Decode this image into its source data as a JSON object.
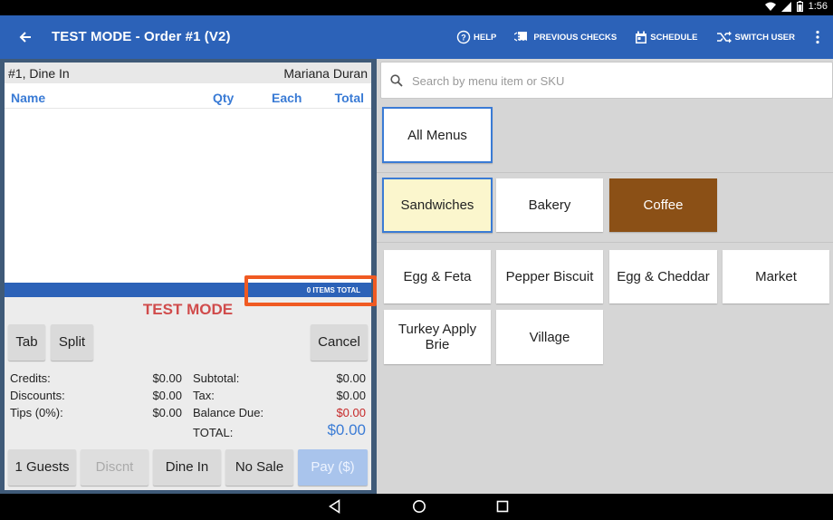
{
  "status": {
    "time": "1:56"
  },
  "appbar": {
    "title": "TEST MODE - Order #1 (V2)",
    "actions": [
      {
        "label": "HELP",
        "icon": "help-icon"
      },
      {
        "label": "PREVIOUS CHECKS",
        "icon": "checks-icon"
      },
      {
        "label": "SCHEDULE",
        "icon": "calendar-icon"
      },
      {
        "label": "SWITCH USER",
        "icon": "shuffle-icon"
      }
    ]
  },
  "order": {
    "header_left": "#1, Dine In",
    "header_right": "Mariana Duran",
    "columns": {
      "name": "Name",
      "qty": "Qty",
      "each": "Each",
      "total": "Total"
    },
    "items_total": "0 ITEMS TOTAL",
    "test_mode": "TEST MODE",
    "buttons": {
      "tab": "Tab",
      "split": "Split",
      "cancel": "Cancel"
    },
    "summary": {
      "credits_label": "Credits:",
      "credits": "$0.00",
      "discounts_label": "Discounts:",
      "discounts": "$0.00",
      "tips_label": "Tips (0%):",
      "tips": "$0.00",
      "subtotal_label": "Subtotal:",
      "subtotal": "$0.00",
      "tax_label": "Tax:",
      "tax": "$0.00",
      "balance_label": "Balance Due:",
      "balance": "$0.00",
      "total_label": "TOTAL:",
      "total": "$0.00"
    },
    "bottom_buttons": {
      "guests": "1 Guests",
      "discount": "Discnt",
      "dine_in": "Dine In",
      "no_sale": "No Sale",
      "pay": "Pay ($)"
    }
  },
  "menu": {
    "search_placeholder": "Search by menu item or SKU",
    "all_menus": "All Menus",
    "categories": [
      "Sandwiches",
      "Bakery",
      "Coffee"
    ],
    "items": [
      "Egg & Feta",
      "Pepper Biscuit",
      "Egg & Cheddar",
      "Market",
      "Turkey Apply Brie",
      "Village"
    ]
  },
  "colors": {
    "accent": "#2c62b8",
    "coffee": "#8b5016",
    "selected_bg": "#fbf6cd",
    "test_mode": "#d04b4b",
    "highlight": "#f05a22"
  }
}
